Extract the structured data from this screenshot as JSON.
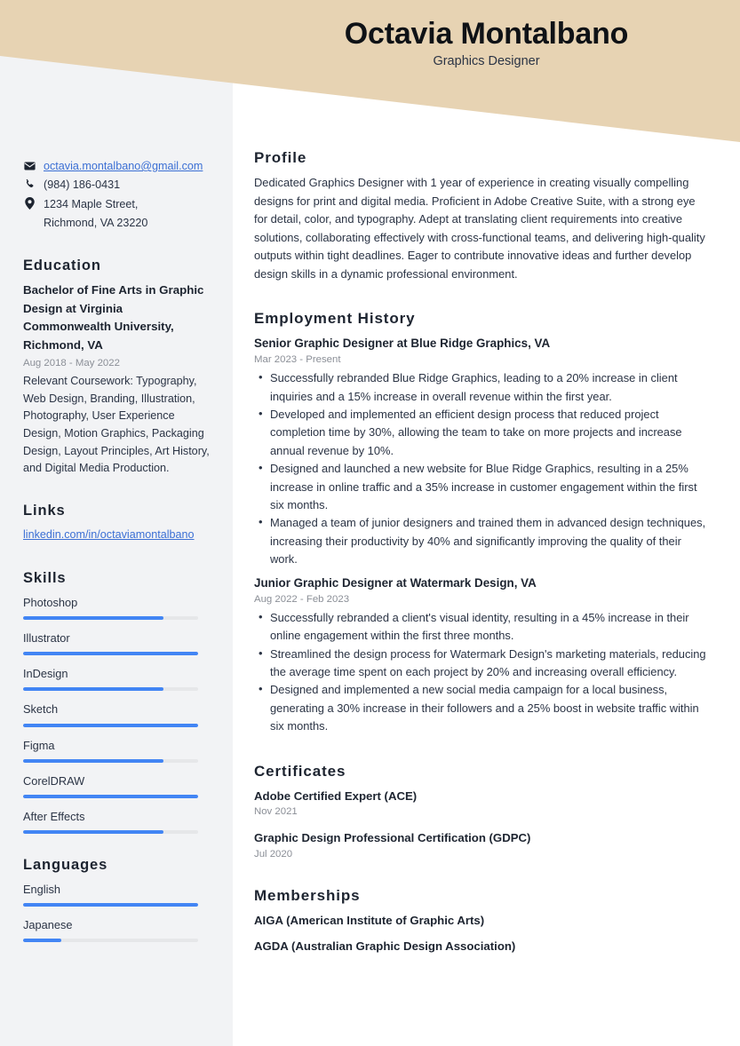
{
  "header": {
    "name": "Octavia Montalbano",
    "job_title": "Graphics Designer",
    "banner_color": "#e7d3b3"
  },
  "theme": {
    "accent": "#4285f4",
    "sidebar_bg": "#f2f3f5",
    "link_color": "#3b6fd4",
    "text": "#2b3445",
    "muted": "#8b8f97"
  },
  "sidebar": {
    "contact": {
      "email": "octavia.montalbano@gmail.com",
      "email_icon": "envelope-icon",
      "phone": "(984) 186-0431",
      "phone_icon": "phone-icon",
      "address_line1": "1234 Maple Street,",
      "address_line2": "Richmond, VA 23220",
      "address_icon": "location-pin-icon"
    },
    "education": {
      "heading": "Education",
      "entries": [
        {
          "title": "Bachelor of Fine Arts in Graphic Design at Virginia Commonwealth University, Richmond, VA",
          "date": "Aug 2018 - May 2022",
          "description": "Relevant Coursework: Typography, Web Design, Branding, Illustration, Photography, User Experience Design, Motion Graphics, Packaging Design, Layout Principles, Art History, and Digital Media Production."
        }
      ]
    },
    "links": {
      "heading": "Links",
      "items": [
        {
          "label": "linkedin.com/in/octaviamontalbano"
        }
      ]
    },
    "skills": {
      "heading": "Skills",
      "items": [
        {
          "label": "Photoshop",
          "level": 80
        },
        {
          "label": "Illustrator",
          "level": 100
        },
        {
          "label": "InDesign",
          "level": 80
        },
        {
          "label": "Sketch",
          "level": 100
        },
        {
          "label": "Figma",
          "level": 80
        },
        {
          "label": "CorelDRAW",
          "level": 100
        },
        {
          "label": "After Effects",
          "level": 80
        }
      ]
    },
    "languages": {
      "heading": "Languages",
      "items": [
        {
          "label": "English",
          "level": 100
        },
        {
          "label": "Japanese",
          "level": 22
        }
      ]
    }
  },
  "main": {
    "profile": {
      "heading": "Profile",
      "text": "Dedicated Graphics Designer with 1 year of experience in creating visually compelling designs for print and digital media. Proficient in Adobe Creative Suite, with a strong eye for detail, color, and typography. Adept at translating client requirements into creative solutions, collaborating effectively with cross-functional teams, and delivering high-quality outputs within tight deadlines. Eager to contribute innovative ideas and further develop design skills in a dynamic professional environment."
    },
    "employment": {
      "heading": "Employment History",
      "jobs": [
        {
          "title": "Senior Graphic Designer at Blue Ridge Graphics, VA",
          "date": "Mar 2023 - Present",
          "bullets": [
            "Successfully rebranded Blue Ridge Graphics, leading to a 20% increase in client inquiries and a 15% increase in overall revenue within the first year.",
            "Developed and implemented an efficient design process that reduced project completion time by 30%, allowing the team to take on more projects and increase annual revenue by 10%.",
            "Designed and launched a new website for Blue Ridge Graphics, resulting in a 25% increase in online traffic and a 35% increase in customer engagement within the first six months.",
            "Managed a team of junior designers and trained them in advanced design techniques, increasing their productivity by 40% and significantly improving the quality of their work."
          ]
        },
        {
          "title": "Junior Graphic Designer at Watermark Design, VA",
          "date": "Aug 2022 - Feb 2023",
          "bullets": [
            "Successfully rebranded a client's visual identity, resulting in a 45% increase in their online engagement within the first three months.",
            "Streamlined the design process for Watermark Design's marketing materials, reducing the average time spent on each project by 20% and increasing overall efficiency.",
            "Designed and implemented a new social media campaign for a local business, generating a 30% increase in their followers and a 25% boost in website traffic within six months."
          ]
        }
      ]
    },
    "certificates": {
      "heading": "Certificates",
      "items": [
        {
          "name": "Adobe Certified Expert (ACE)",
          "date": "Nov 2021"
        },
        {
          "name": "Graphic Design Professional Certification (GDPC)",
          "date": "Jul 2020"
        }
      ]
    },
    "memberships": {
      "heading": "Memberships",
      "items": [
        {
          "name": "AIGA (American Institute of Graphic Arts)"
        },
        {
          "name": "AGDA (Australian Graphic Design Association)"
        }
      ]
    }
  }
}
